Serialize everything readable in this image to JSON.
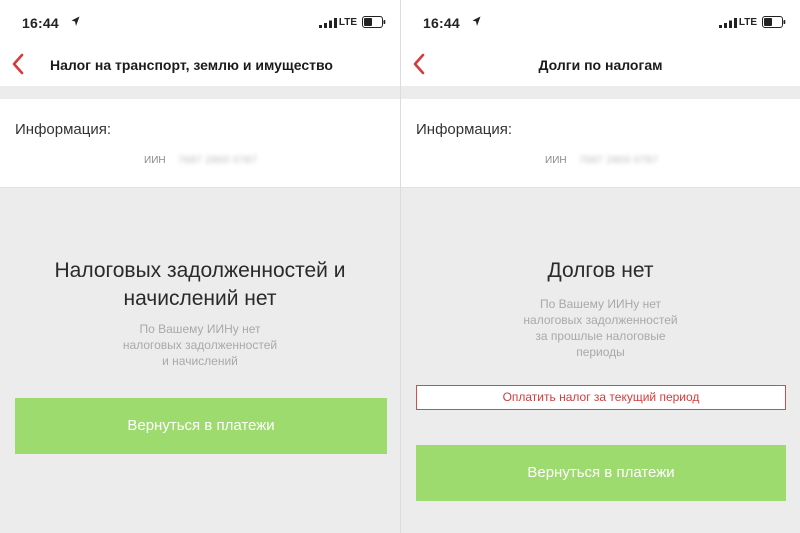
{
  "colors": {
    "accent_red": "#d63b3b",
    "button_green": "#9edb6f",
    "background_gray": "#ececec"
  },
  "icons": {
    "back": "chevron-left-icon",
    "location": "location-arrow-icon",
    "signal": "signal-bars-icon",
    "battery": "battery-icon"
  },
  "screens": [
    {
      "status": {
        "time": "16:44",
        "network": "LTE"
      },
      "header": {
        "title": "Налог на транспорт, землю и имущество"
      },
      "info": {
        "label": "Информация:",
        "iin_label": "ИИН",
        "iin_value": "7687 2800 0787"
      },
      "message": {
        "headline_lines": [
          "Налоговых задолженностей и",
          "начислений нет"
        ],
        "subtext_lines": [
          "По Вашему ИИНу нет",
          "налоговых задолженностей",
          "и начислений"
        ]
      },
      "buttons": {
        "return_label": "Вернуться в платежи"
      }
    },
    {
      "status": {
        "time": "16:44",
        "network": "LTE"
      },
      "header": {
        "title": "Долги по налогам"
      },
      "info": {
        "label": "Информация:",
        "iin_label": "ИИН",
        "iin_value": "7687 2800 0787"
      },
      "message": {
        "headline_lines": [
          "Долгов нет"
        ],
        "subtext_lines": [
          "По Вашему ИИНу нет",
          "налоговых задолженностей",
          "за прошлые налоговые",
          "периоды"
        ]
      },
      "buttons": {
        "pay_current_label": "Оплатить налог за текущий период",
        "return_label": "Вернуться в платежи"
      }
    }
  ]
}
